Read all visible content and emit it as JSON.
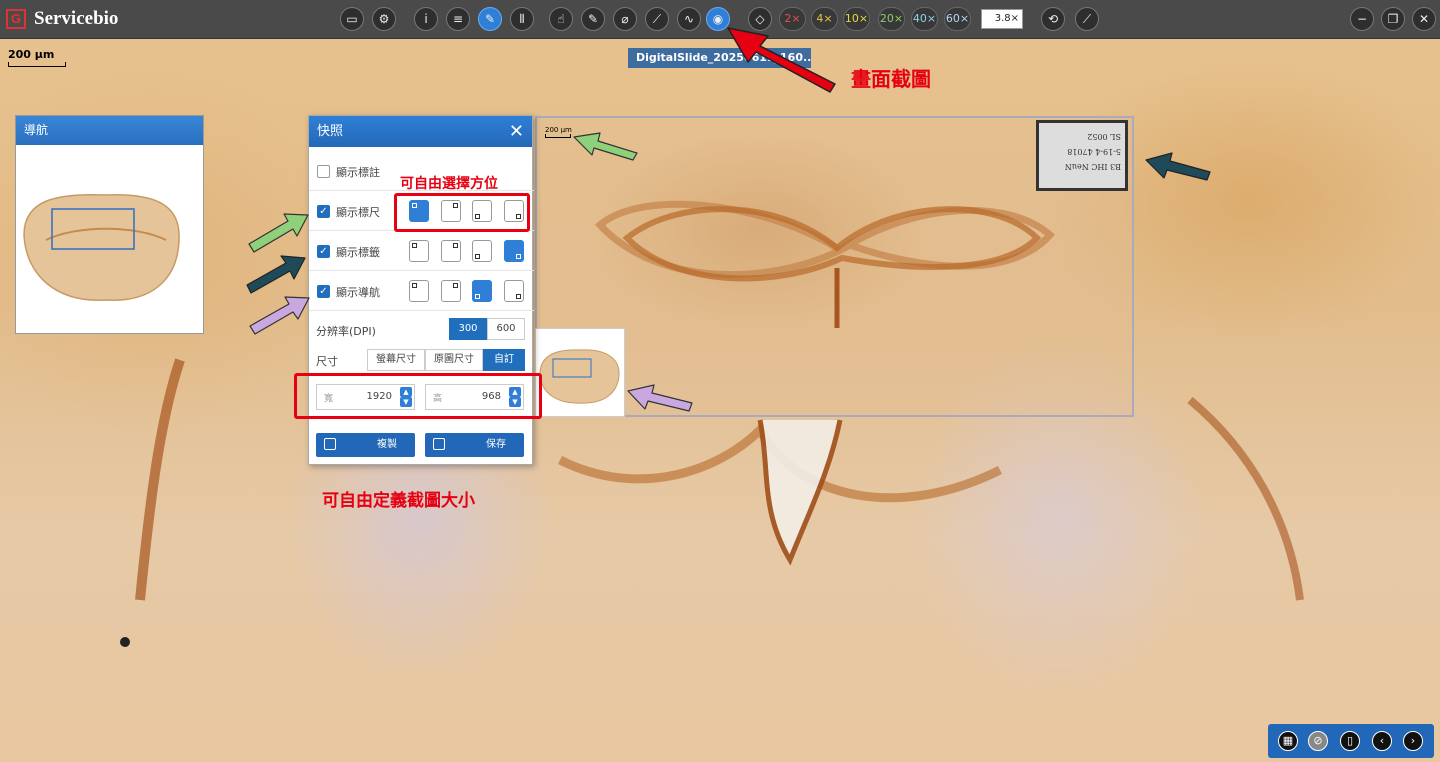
{
  "app": {
    "title": "Servicebio",
    "logo_letter": "G"
  },
  "toolbar": {
    "buttons": [
      {
        "name": "open-folder",
        "glyph": "▭"
      },
      {
        "name": "settings",
        "glyph": "⚙"
      },
      {
        "name": "info",
        "glyph": "i"
      },
      {
        "name": "list",
        "glyph": "≡"
      },
      {
        "name": "pen",
        "glyph": "✎"
      },
      {
        "name": "barcode",
        "glyph": "⦀"
      },
      {
        "name": "hand",
        "glyph": "☝"
      },
      {
        "name": "edit",
        "glyph": "✎"
      },
      {
        "name": "eraser",
        "glyph": "⌀"
      },
      {
        "name": "measure",
        "glyph": "⟋"
      },
      {
        "name": "curve",
        "glyph": "∿"
      },
      {
        "name": "snapshot",
        "glyph": "◉"
      },
      {
        "name": "fit",
        "glyph": "◇"
      }
    ],
    "zoom_levels": [
      {
        "label": "2×",
        "color": "#e05050"
      },
      {
        "label": "4×",
        "color": "#e6c34a"
      },
      {
        "label": "10×",
        "color": "#e6d84a"
      },
      {
        "label": "20×",
        "color": "#8ad06a"
      },
      {
        "label": "40×",
        "color": "#8fd2e8"
      },
      {
        "label": "60×",
        "color": "#b8d4f0"
      }
    ],
    "zoom_value": "3.8×"
  },
  "scale_bar": {
    "label": "200 µm"
  },
  "file_tab": {
    "label": "DigitalSlide_20250611_160..."
  },
  "navigator": {
    "title": "導航"
  },
  "snapshot": {
    "title": "快照",
    "options": [
      {
        "label": "顯示標註",
        "checked": false
      },
      {
        "label": "顯示標尺",
        "checked": true
      },
      {
        "label": "顯示標籤",
        "checked": true
      },
      {
        "label": "顯示導航",
        "checked": true
      }
    ],
    "resolution_label": "分辨率(DPI)",
    "dpi_options": [
      "300",
      "600"
    ],
    "size_label": "尺寸",
    "size_options": [
      "螢幕尺寸",
      "原圖尺寸",
      "自訂"
    ],
    "width_placeholder": "寬",
    "width_value": "1920",
    "height_placeholder": "高",
    "height_value": "968",
    "copy_label": "複製",
    "save_label": "保存"
  },
  "preview": {
    "scale_label": "200 µm",
    "slide_label_lines": [
      "B3 IHC NeuN",
      "5-19-4 47018",
      "SL 0052"
    ]
  },
  "annotations": {
    "screenshot": "畫面截圖",
    "free_position": "可自由選擇方位",
    "free_size": "可自由定義截圖大小"
  },
  "colors": {
    "accent": "#2f7fd6",
    "annotation_red": "#e60012",
    "toolbar_bg": "#4a4a4a"
  }
}
